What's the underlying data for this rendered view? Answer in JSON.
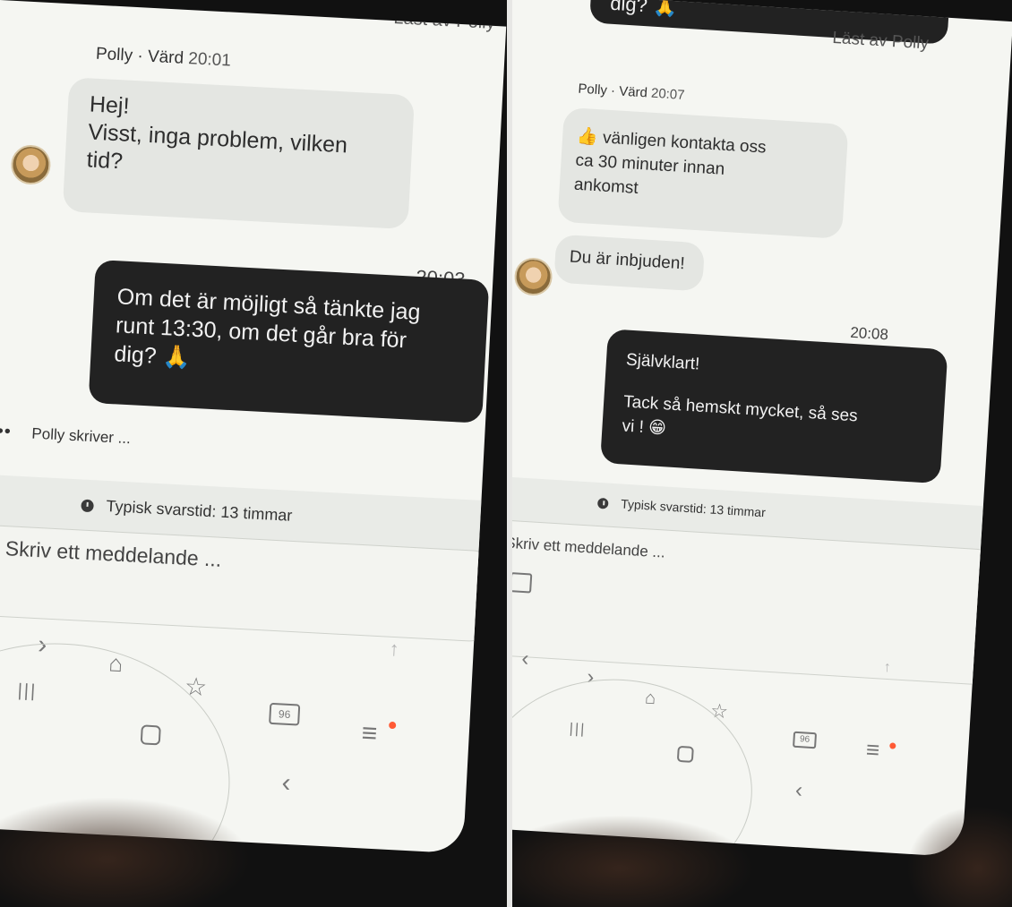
{
  "left": {
    "top_fragment": "Läst av Polly",
    "header": {
      "sender": "Polly · Värd",
      "time": "20:01"
    },
    "incoming": {
      "lines": [
        "Hej!",
        "Visst, inga problem, vilken",
        "tid?"
      ]
    },
    "outgoing": {
      "time": "20:03",
      "lines": [
        "Om det är möjligt så tänkte jag",
        "runt 13:30, om det går bra för",
        "dig? 🙏"
      ]
    },
    "typing": "Polly skriver ...",
    "response_info": "Typisk svarstid: 13 timmar",
    "composer_placeholder": "Skriv ett meddelande ...",
    "tab_count": "96"
  },
  "right": {
    "top_fragment": "dig? 🙏",
    "read_receipt": "Läst av Polly",
    "header": {
      "sender": "Polly · Värd",
      "time": "20:07"
    },
    "incoming1": {
      "lines": [
        "👍 vänligen kontakta oss",
        "ca 30 minuter innan",
        "ankomst"
      ]
    },
    "incoming2": {
      "text": "Du är inbjuden!"
    },
    "outgoing": {
      "time": "20:08",
      "lines": [
        "Självklart!",
        "",
        "Tack så hemskt mycket, så ses",
        "vi ! 😁"
      ]
    },
    "response_info": "Typisk svarstid: 13 timmar",
    "composer_placeholder": "Skriv ett meddelande ...",
    "tab_count": "96"
  },
  "colors": {
    "screen_bg": "#f5f6f2",
    "incoming_bubble": "#e4e6e2",
    "outgoing_bubble": "#222222",
    "notification_dot": "#ff5a35"
  },
  "icons": [
    "clock-icon",
    "image-attach-icon",
    "back-arrow-icon",
    "forward-arrow-icon",
    "home-icon",
    "bookmark-star-icon",
    "tabs-icon",
    "menu-icon",
    "send-arrow-icon",
    "recents-icon",
    "home-gesture-icon",
    "back-gesture-icon"
  ]
}
